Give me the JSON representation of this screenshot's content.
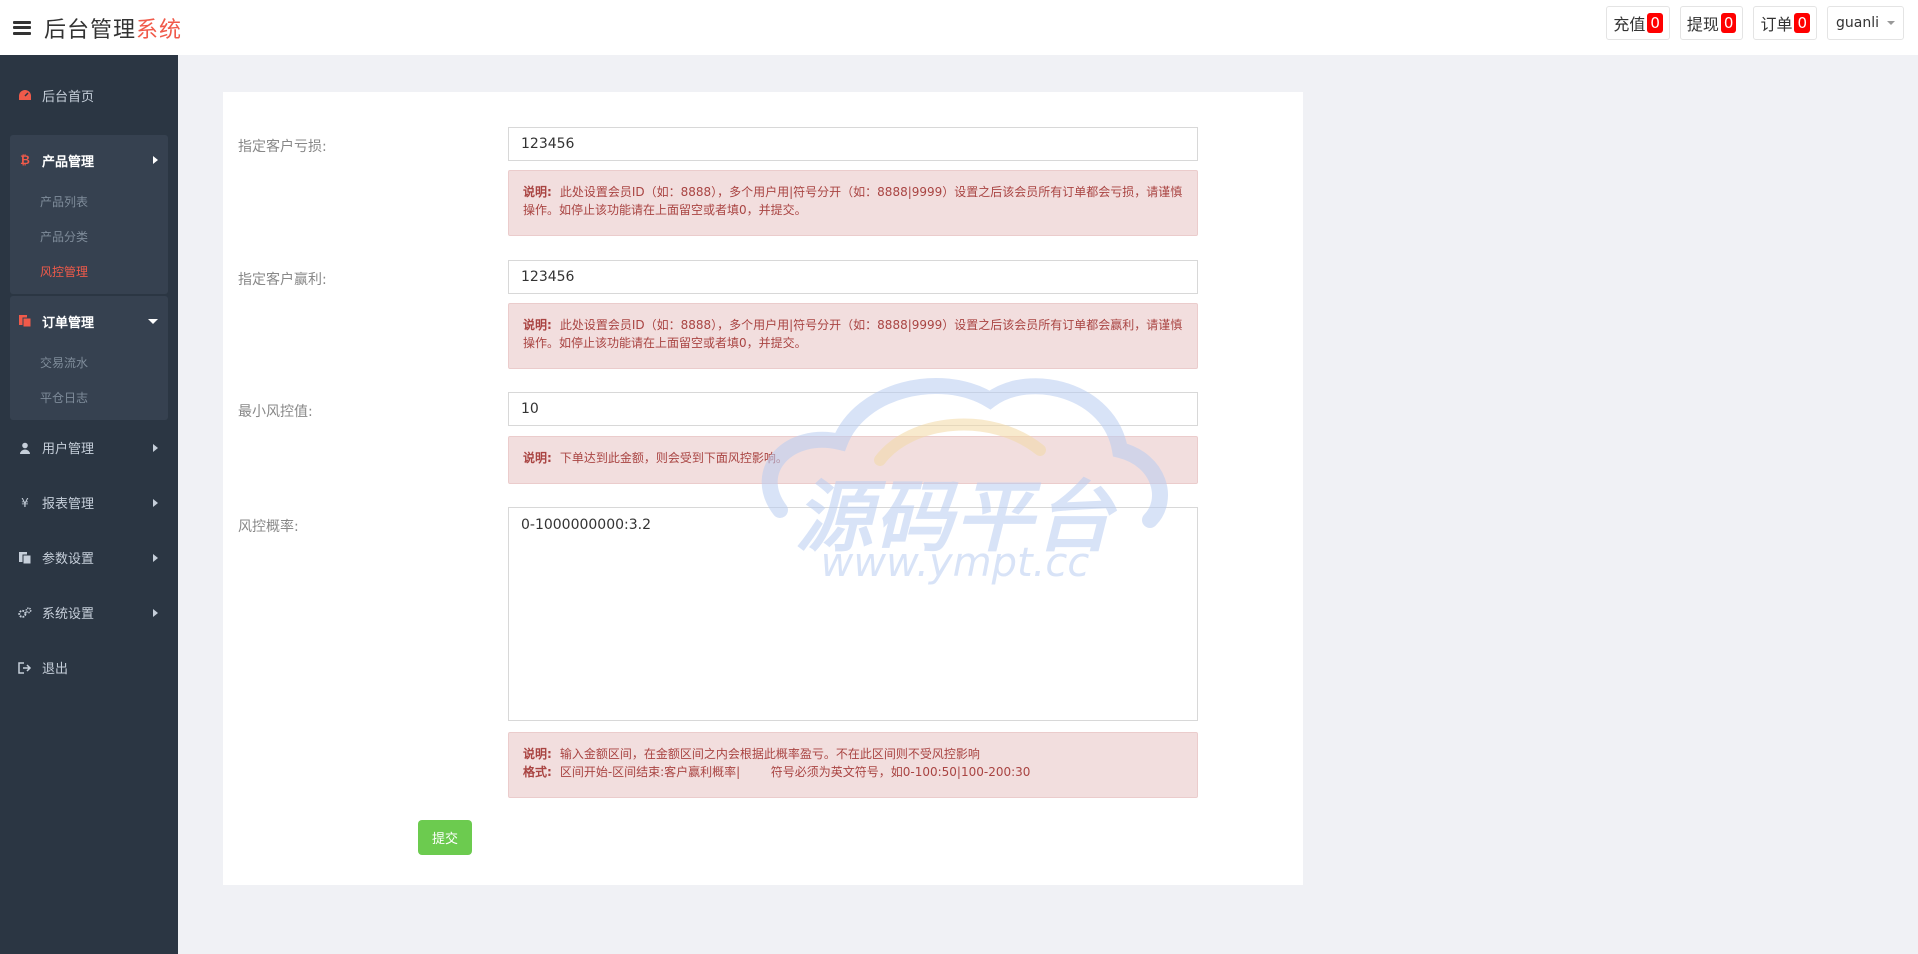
{
  "header": {
    "brand_main": "后台管理",
    "brand_accent": "系统",
    "buttons": [
      {
        "label": "充值",
        "count": "0"
      },
      {
        "label": "提现",
        "count": "0"
      },
      {
        "label": "订单",
        "count": "0"
      }
    ],
    "user": "guanli"
  },
  "sidebar": {
    "home": "后台首页",
    "product_group": {
      "label": "产品管理",
      "items": [
        "产品列表",
        "产品分类",
        "风控管理"
      ],
      "active": "风控管理"
    },
    "order_group": {
      "label": "订单管理",
      "items": [
        "交易流水",
        "平仓日志"
      ]
    },
    "others": [
      "用户管理",
      "报表管理",
      "参数设置",
      "系统设置"
    ],
    "logout": "退出"
  },
  "form": {
    "loss": {
      "label": "指定客户亏损:",
      "value": "123456",
      "note_label": "说明:",
      "note_text": "此处设置会员ID（如：8888），多个用户用|符号分开（如：8888|9999）设置之后该会员所有订单都会亏损，请谨慎操作。如停止该功能请在上面留空或者填0，并提交。"
    },
    "profit": {
      "label": "指定客户赢利:",
      "value": "123456",
      "note_label": "说明:",
      "note_text": "此处设置会员ID（如：8888），多个用户用|符号分开（如：8888|9999）设置之后该会员所有订单都会赢利，请谨慎操作。如停止该功能请在上面留空或者填0，并提交。"
    },
    "min_risk": {
      "label": "最小风控值:",
      "value": "10",
      "note_label": "说明:",
      "note_text": "下单达到此金额，则会受到下面风控影响。"
    },
    "risk_rate": {
      "label": "风控概率:",
      "value": "0-1000000000:3.2",
      "note_label": "说明:",
      "note_text": "输入金额区间，在金额区间之内会根据此概率盈亏。不在此区间则不受风控影响",
      "format_label": "格式:",
      "format_text": "区间开始-区间结束:客户赢利概率|        符号必须为英文符号，如0-100:50|100-200:30"
    },
    "submit_label": "提交"
  },
  "watermark": {
    "main": "源码平台",
    "url": "www.ympt.cc"
  }
}
